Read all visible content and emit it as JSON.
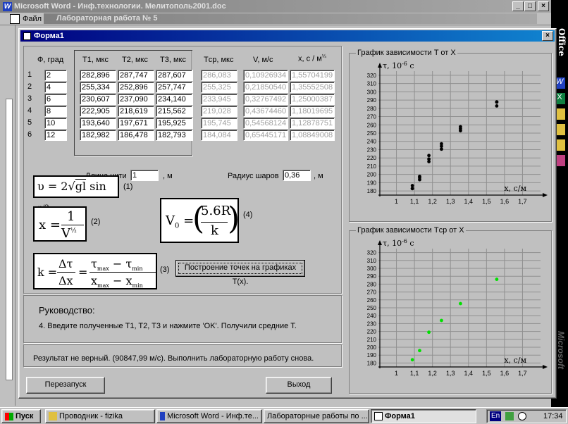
{
  "word": {
    "title": "Microsoft Word - Инф.технологии. Мелитополь2001.doc",
    "menu_file": "Файл",
    "subwindow_title": "Лабораторная работа № 5"
  },
  "form": {
    "title": "Форма1",
    "headers": {
      "phi": "Ф, град",
      "t1": "T1, мкс",
      "t2": "T2, мкс",
      "t3": "T3, мкс",
      "tcp": "Tср, мкс",
      "v": "V, м/с",
      "x": "x, с / м"
    },
    "rows": [
      {
        "n": "1",
        "phi": "2",
        "t1": "282,896",
        "t2": "287,747",
        "t3": "287,607",
        "tcp": "286,083",
        "v": "0,10926934",
        "x": "1,55704199"
      },
      {
        "n": "2",
        "phi": "4",
        "t1": "255,334",
        "t2": "252,896",
        "t3": "257,747",
        "tcp": "255,325",
        "v": "0,21850540",
        "x": "1,35552508"
      },
      {
        "n": "3",
        "phi": "6",
        "t1": "230,607",
        "t2": "237,090",
        "t3": "234,140",
        "tcp": "233,945",
        "v": "0,32767492",
        "x": "1,25000387"
      },
      {
        "n": "4",
        "phi": "8",
        "t1": "222,905",
        "t2": "218,619",
        "t3": "215,562",
        "tcp": "219,028",
        "v": "0,43674460",
        "x": "1,18019695"
      },
      {
        "n": "5",
        "phi": "10",
        "t1": "193,640",
        "t2": "197,671",
        "t3": "195,925",
        "tcp": "195,745",
        "v": "0,54568124",
        "x": "1,12878751"
      },
      {
        "n": "6",
        "phi": "12",
        "t1": "182,982",
        "t2": "186,478",
        "t3": "182,793",
        "tcp": "184,084",
        "v": "0,65445171",
        "x": "1,08849008"
      }
    ],
    "length_label": "Длина нити",
    "length_value": "1",
    "length_unit": ", м",
    "radius_label": "Радиус шаров",
    "radius_value": "0,36",
    "radius_unit": ", м",
    "plot_button": "Построение точек на графиках T(x).",
    "guide_title": "Руководство:",
    "guide_text": "4. Введите полученные T1, T2, T3 и нажмите 'OK'. Получили средние Т.",
    "result_text": "Результат не верный. (90847,99 м/с). Выполнить лабораторную работу снова.",
    "restart_button": "Перезапуск",
    "exit_button": "Выход",
    "formula_labels": [
      "(1)",
      "(2)",
      "(3)",
      "(4)"
    ]
  },
  "charts": {
    "chart1_title": "График зависимости T от X",
    "chart2_title": "График зависимости Tср от X",
    "y_axis_label": "τ, 10",
    "y_axis_exp": "-6",
    "y_axis_unit": " c",
    "x_axis_label": "x, c/м",
    "y_ticks": [
      "180",
      "190",
      "200",
      "210",
      "220",
      "230",
      "240",
      "250",
      "260",
      "270",
      "280",
      "290",
      "300",
      "310",
      "320"
    ],
    "x_ticks": [
      "1",
      "1,1",
      "1,2",
      "1,3",
      "1,4",
      "1,5",
      "1,6",
      "1,7"
    ]
  },
  "chart_data": [
    {
      "type": "scatter",
      "title": "График зависимости T от X",
      "xlabel": "x, c/м",
      "ylabel": "τ, 10-6 c",
      "xlim": [
        0.9,
        1.8
      ],
      "ylim": [
        175,
        325
      ],
      "color": "#000000",
      "x": [
        1.08849008,
        1.08849008,
        1.08849008,
        1.12878751,
        1.12878751,
        1.12878751,
        1.18019695,
        1.18019695,
        1.18019695,
        1.25000387,
        1.25000387,
        1.25000387,
        1.35552508,
        1.35552508,
        1.35552508,
        1.55704199,
        1.55704199,
        1.55704199
      ],
      "y": [
        182.982,
        186.478,
        182.793,
        193.64,
        197.671,
        195.925,
        222.905,
        218.619,
        215.562,
        230.607,
        237.09,
        234.14,
        255.334,
        252.896,
        257.747,
        282.896,
        287.747,
        287.607
      ]
    },
    {
      "type": "scatter",
      "title": "График зависимости Tср от X",
      "xlabel": "x, c/м",
      "ylabel": "τ, 10-6 c",
      "xlim": [
        0.9,
        1.8
      ],
      "ylim": [
        175,
        325
      ],
      "color": "#00e000",
      "x": [
        1.08849008,
        1.12878751,
        1.18019695,
        1.25000387,
        1.35552508,
        1.55704199
      ],
      "y": [
        184.084,
        195.745,
        219.028,
        233.945,
        255.325,
        286.083
      ]
    }
  ],
  "taskbar": {
    "start": "Пуск",
    "items": [
      "Проводник - fizika",
      "Microsoft Word - Инф.те...",
      "Лабораторные работы по ...",
      "Форма1"
    ],
    "lang": "En",
    "time": "17:34"
  },
  "office_bar": {
    "label": "Office",
    "side_text": "Microsoft"
  }
}
